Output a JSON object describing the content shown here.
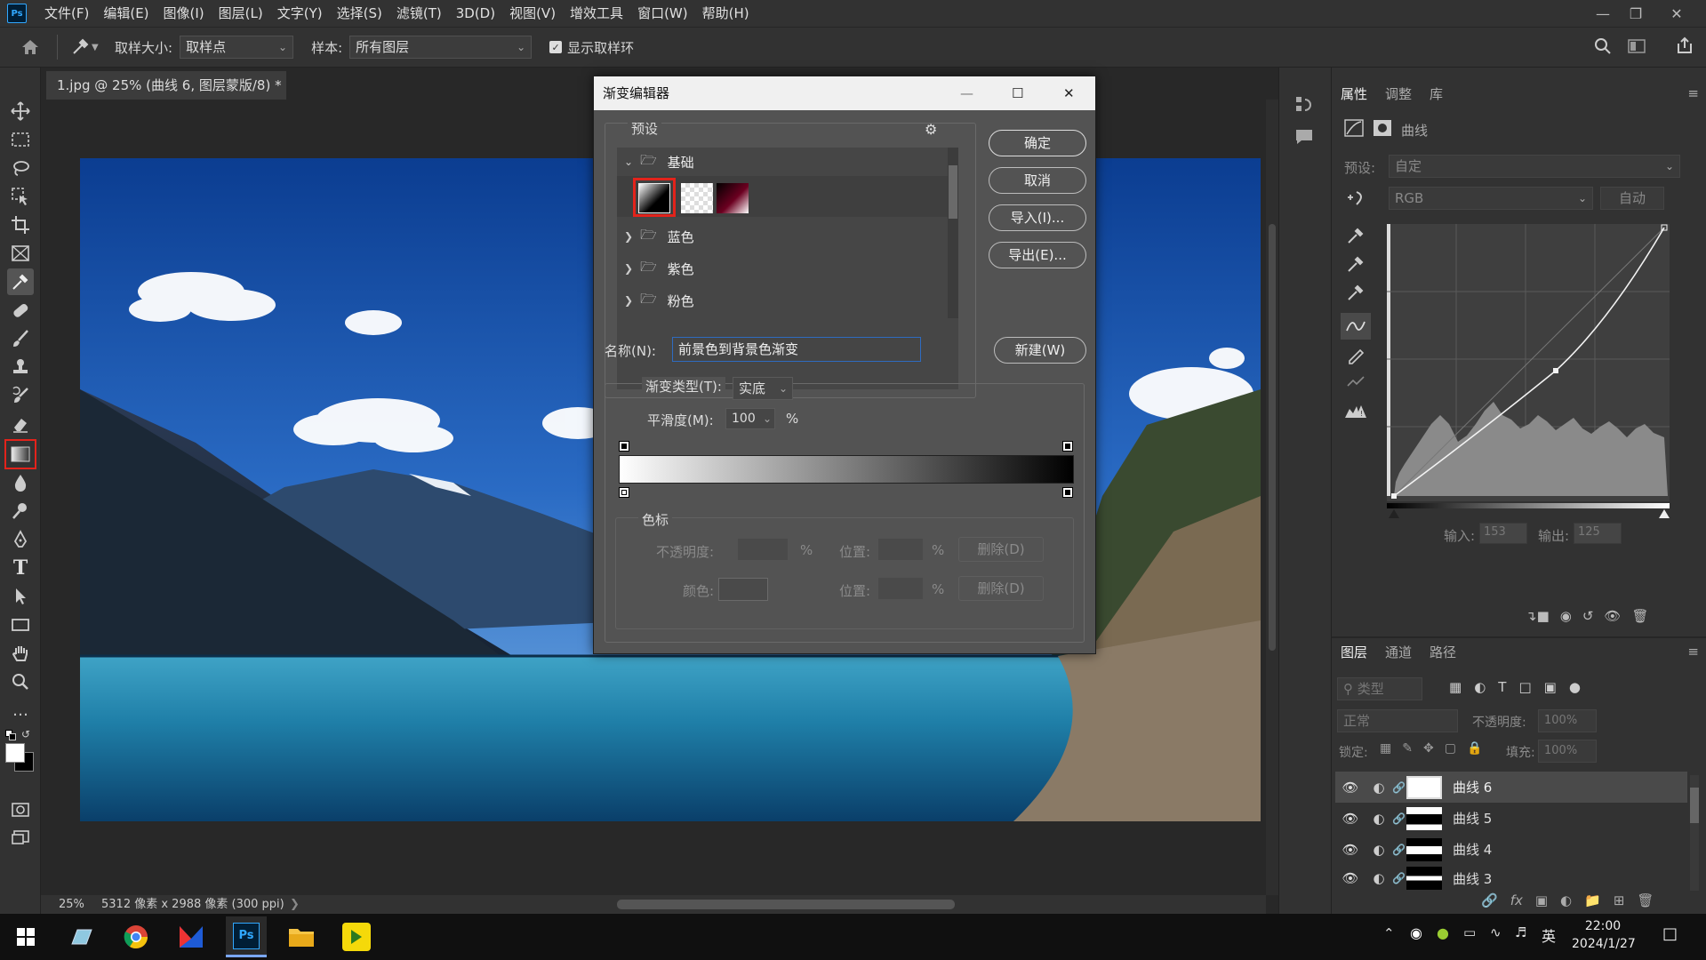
{
  "menu": {
    "app_logo": "Ps",
    "items": [
      "文件(F)",
      "编辑(E)",
      "图像(I)",
      "图层(L)",
      "文字(Y)",
      "选择(S)",
      "滤镜(T)",
      "3D(D)",
      "视图(V)",
      "增效工具",
      "窗口(W)",
      "帮助(H)"
    ]
  },
  "options": {
    "sample_size_label": "取样大小:",
    "sample_size_value": "取样点",
    "sample_label": "样本:",
    "sample_value": "所有图层",
    "show_ring_label": "显示取样环"
  },
  "document": {
    "tab_title": "1.jpg @ 25% (曲线 6, 图层蒙版/8) *",
    "zoom": "25%",
    "dimensions": "5312 像素 x 2988 像素 (300 ppi)"
  },
  "dialog": {
    "title": "渐变编辑器",
    "presets_label": "预设",
    "folders": [
      "基础",
      "蓝色",
      "紫色",
      "粉色"
    ],
    "buttons": {
      "ok": "确定",
      "cancel": "取消",
      "import": "导入(I)...",
      "export": "导出(E)...",
      "new": "新建(W)"
    },
    "name_label": "名称(N):",
    "name_value": "前景色到背景色渐变",
    "gradient_type_label": "渐变类型(T):",
    "gradient_type_value": "实底",
    "smoothness_label": "平滑度(M):",
    "smoothness_value": "100",
    "percent": "%",
    "color_stops_label": "色标",
    "opacity_label": "不透明度:",
    "position_label": "位置:",
    "delete_label": "删除(D)",
    "color_label": "颜色:"
  },
  "properties": {
    "tabs": [
      "属性",
      "调整",
      "库"
    ],
    "panel_title": "曲线",
    "preset_label": "预设:",
    "preset_value": "自定",
    "channel_value": "RGB",
    "auto_label": "自动",
    "input_label": "输入:",
    "input_value": "153",
    "output_label": "输出:",
    "output_value": "125"
  },
  "layers": {
    "tabs": [
      "图层",
      "通道",
      "路径"
    ],
    "filter_placeholder": "类型",
    "blend_mode": "正常",
    "opacity_label": "不透明度:",
    "opacity_value": "100%",
    "lock_label": "锁定:",
    "fill_label": "填充:",
    "fill_value": "100%",
    "items": [
      "曲线 6",
      "曲线 5",
      "曲线 4",
      "曲线 3"
    ]
  },
  "taskbar": {
    "time": "22:00",
    "date": "2024/1/27",
    "ime": "英"
  },
  "colors": {
    "accent_red": "#e3231b",
    "panel_bg": "#323232",
    "dialog_bg": "#535353"
  }
}
